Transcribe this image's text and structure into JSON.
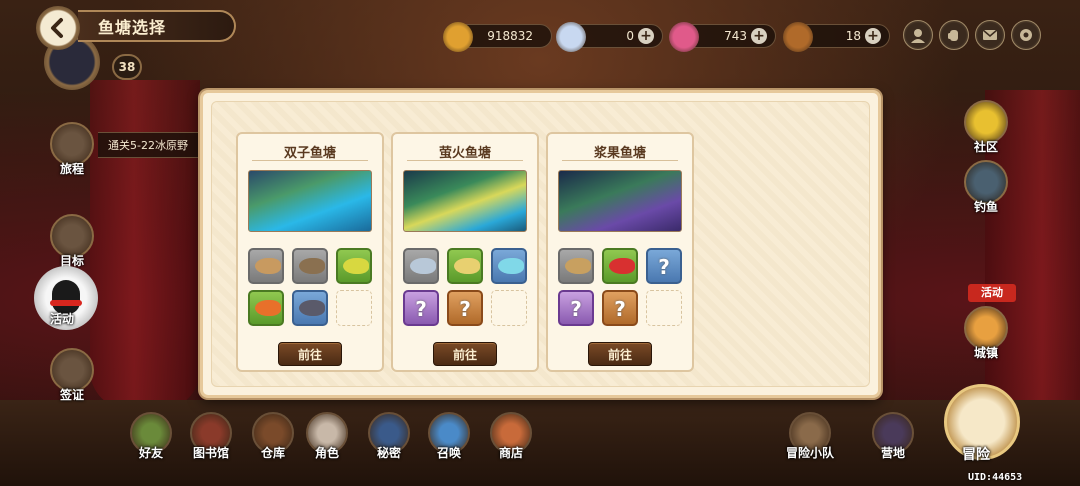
{
  "header": {
    "title": "鱼塘选择",
    "level": "38"
  },
  "currencies": [
    {
      "name": "gold",
      "value": "918832",
      "has_plus": false,
      "color": "#e0a030"
    },
    {
      "name": "diamond",
      "value": "0",
      "has_plus": true,
      "color": "#c8d8f0"
    },
    {
      "name": "pink-crystal",
      "value": "743",
      "has_plus": true,
      "color": "#e05a8a"
    },
    {
      "name": "bread",
      "value": "18",
      "has_plus": true,
      "color": "#b06a2a"
    }
  ],
  "top_icons": [
    "character-icon",
    "hand-icon",
    "mail-icon",
    "gear-icon"
  ],
  "side_menu": {
    "journey": "旅程",
    "quest": "通关5-22冰原野",
    "goal": "目标",
    "activity": "活动",
    "visa": "签证"
  },
  "right_menu": {
    "community": "社区",
    "fishing": "钓鱼",
    "event_tag": "活动",
    "town": "城镇"
  },
  "dock": [
    "好友",
    "图书馆",
    "仓库",
    "角色",
    "秘密",
    "召唤",
    "商店",
    "冒险小队",
    "营地"
  ],
  "adventure": "冒险",
  "uid": "UID:44653",
  "ponds": [
    {
      "name": "双子鱼塘",
      "theme": "twin",
      "slots": [
        {
          "type": "fish",
          "rarity": "grey",
          "fish_color": "#c89a60"
        },
        {
          "type": "fish",
          "rarity": "grey",
          "fish_color": "#8a7050"
        },
        {
          "type": "fish",
          "rarity": "green",
          "fish_color": "#d8d840"
        },
        {
          "type": "fish",
          "rarity": "green",
          "fish_color": "#e8702a"
        },
        {
          "type": "fish",
          "rarity": "blue",
          "fish_color": "#5a5a6a"
        },
        {
          "type": "empty"
        }
      ],
      "button": "前往"
    },
    {
      "name": "萤火鱼塘",
      "theme": "firefly",
      "slots": [
        {
          "type": "fish",
          "rarity": "grey",
          "fish_color": "#b8c8d8"
        },
        {
          "type": "fish",
          "rarity": "green",
          "fish_color": "#e8d070"
        },
        {
          "type": "fish",
          "rarity": "blue",
          "fish_color": "#80d8e8"
        },
        {
          "type": "unknown",
          "rarity": "purple"
        },
        {
          "type": "unknown",
          "rarity": "orange"
        },
        {
          "type": "empty"
        }
      ],
      "button": "前往"
    },
    {
      "name": "浆果鱼塘",
      "theme": "berry",
      "slots": [
        {
          "type": "fish",
          "rarity": "grey",
          "fish_color": "#c8a060"
        },
        {
          "type": "fish",
          "rarity": "green",
          "fish_color": "#d83030"
        },
        {
          "type": "unknown",
          "rarity": "blue"
        },
        {
          "type": "unknown",
          "rarity": "purple"
        },
        {
          "type": "unknown",
          "rarity": "orange"
        },
        {
          "type": "empty"
        }
      ],
      "button": "前往"
    }
  ]
}
